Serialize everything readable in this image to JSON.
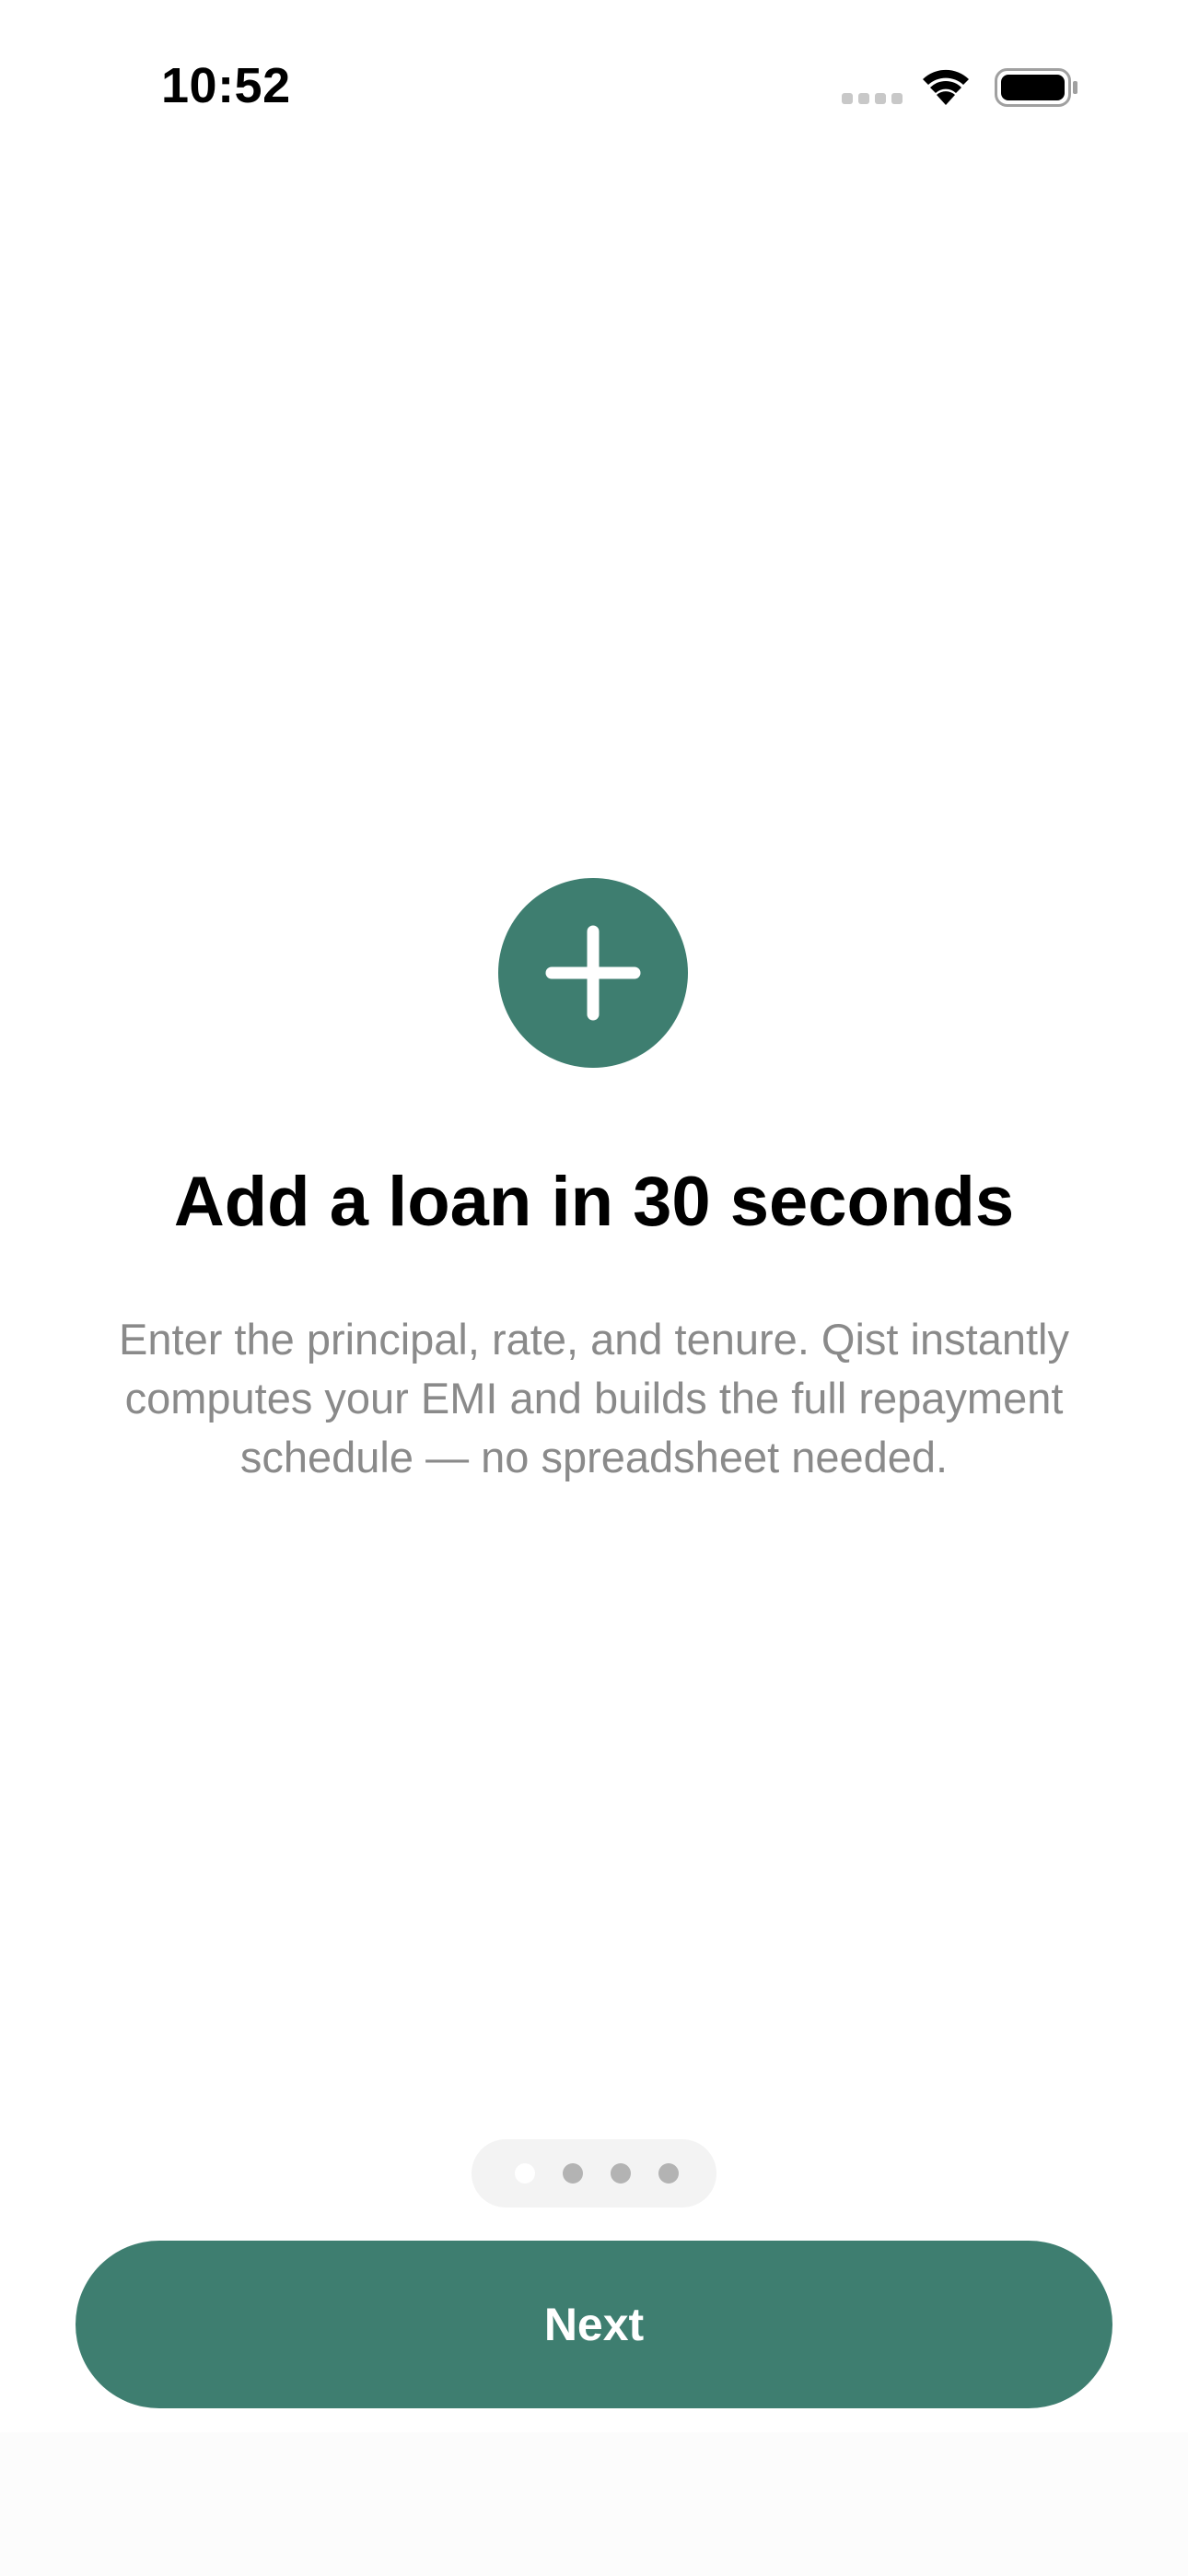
{
  "status_bar": {
    "time": "10:52",
    "icons": [
      "cellular-signal-icon",
      "wifi-icon",
      "battery-icon"
    ]
  },
  "onboarding": {
    "icon": "plus-icon",
    "title": "Add a loan in 30 seconds",
    "description": "Enter the principal, rate, and tenure. Qist instantly computes your EMI and builds the full repayment schedule — no spreadsheet needed.",
    "page_count": 4,
    "current_page": 1
  },
  "actions": {
    "next_label": "Next"
  },
  "colors": {
    "accent": "#3e7e70",
    "title_text": "#000000",
    "body_text": "#8a8a8a",
    "indicator_track": "#f3f3f3",
    "indicator_dot": "#b3b3b3"
  }
}
